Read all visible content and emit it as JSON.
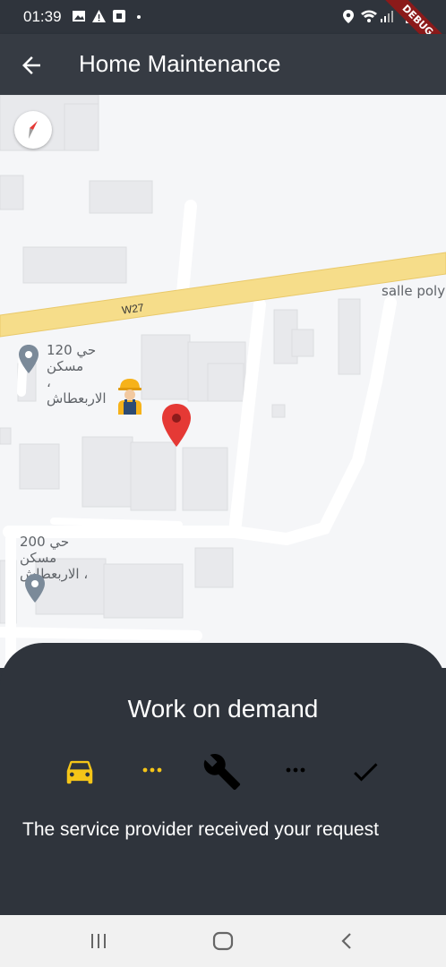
{
  "status_bar": {
    "time": "01:39",
    "icons": [
      "image-icon",
      "warning-icon",
      "square-app-icon",
      "dot-icon",
      "location-icon",
      "wifi-icon",
      "signal-icon",
      "battery-icon"
    ]
  },
  "debug_banner": "DEBUG",
  "app_bar": {
    "back_icon": "arrow-left-icon",
    "title": "Home Maintenance"
  },
  "map": {
    "road_label": "W27",
    "place_label_right": "salle poly",
    "places": [
      {
        "line1": "حي 120 مسكن",
        "line2": "، الاربعطاش"
      },
      {
        "line1": "حي 200 مسكن",
        "line2": "، الاربعطاش"
      }
    ],
    "markers": [
      "worker-avatar-icon",
      "red-location-pin-icon"
    ],
    "compass_icon": "compass-icon"
  },
  "sheet": {
    "title": "Work on demand",
    "steps": [
      {
        "icon": "car-icon",
        "color": "#f5c518",
        "state": "done"
      },
      {
        "icon": "dots-icon",
        "color": "#f5c518"
      },
      {
        "icon": "wrench-icon",
        "color": "#000000"
      },
      {
        "icon": "dots-icon",
        "color": "#000000"
      },
      {
        "icon": "check-icon",
        "color": "#000000"
      }
    ],
    "message": "The service provider received your request"
  },
  "nav_bar": {
    "buttons": [
      "recents-icon",
      "home-icon",
      "back-icon"
    ]
  },
  "colors": {
    "app_bar": "#363b43",
    "sheet": "#2f343c",
    "road_major": "#f6dd8a",
    "accent_yellow": "#f5c518",
    "pin_red": "#e53935"
  }
}
